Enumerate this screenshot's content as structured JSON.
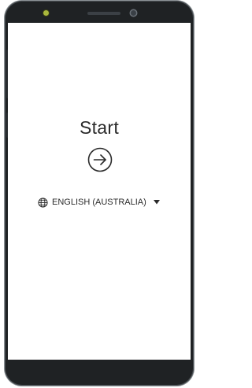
{
  "welcome": {
    "title": "Start",
    "start_icon": "arrow-right-circle-icon"
  },
  "language": {
    "icon": "globe-icon",
    "label": "ENGLISH (AUSTRALIA)",
    "dropdown_icon": "caret-down-icon"
  },
  "device": {
    "front_camera_icon": "camera-icon",
    "sensor_icon": "sensor-icon",
    "speaker": "earpiece-speaker"
  },
  "colors": {
    "phone_frame": "#1f2224",
    "screen_background": "#ffffff",
    "text": "#2b2b2b"
  }
}
